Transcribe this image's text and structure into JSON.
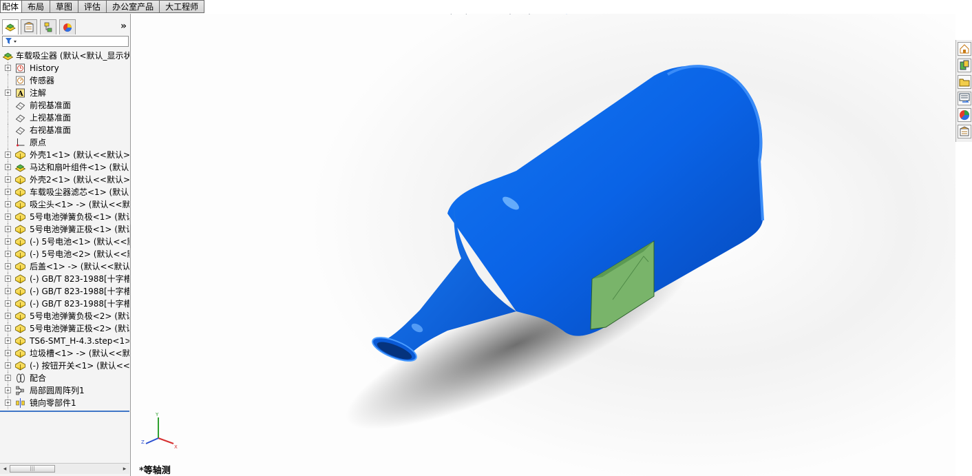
{
  "tabs": [
    "配体",
    "布局",
    "草图",
    "评估",
    "办公室产品",
    "大工程师"
  ],
  "panel": {
    "more_glyph": "»",
    "tabs": [
      "feature-manager-icon",
      "property-manager-icon",
      "configuration-manager-icon",
      "display-manager-icon"
    ]
  },
  "tree": {
    "root_label": "车载吸尘器  (默认<默认_显示状",
    "items": [
      {
        "label": "History",
        "icon": "history-folder-icon",
        "expand": "+"
      },
      {
        "label": "传感器",
        "icon": "sensor-icon",
        "expand": ""
      },
      {
        "label": "注解",
        "icon": "annotation-icon",
        "expand": "+"
      },
      {
        "label": "前视基准面",
        "icon": "plane-icon",
        "expand": ""
      },
      {
        "label": "上视基准面",
        "icon": "plane-icon",
        "expand": ""
      },
      {
        "label": "右视基准面",
        "icon": "plane-icon",
        "expand": ""
      },
      {
        "label": "原点",
        "icon": "origin-icon",
        "expand": ""
      },
      {
        "label": "外壳1<1> (默认<<默认>_",
        "icon": "part-icon",
        "expand": "+"
      },
      {
        "label": "马达和扇叶组件<1> (默认<",
        "icon": "subassembly-icon",
        "expand": "+"
      },
      {
        "label": "外壳2<1> (默认<<默认>_",
        "icon": "part-icon",
        "expand": "+"
      },
      {
        "label": "车载吸尘器滤芯<1> (默认<",
        "icon": "part-icon",
        "expand": "+"
      },
      {
        "label": "吸尘头<1> -> (默认<<默认",
        "icon": "part-icon",
        "expand": "+"
      },
      {
        "label": "5号电池弹簧负极<1> (默认",
        "icon": "part-icon",
        "expand": "+"
      },
      {
        "label": "5号电池弹簧正极<1> (默认",
        "icon": "part-icon",
        "expand": "+"
      },
      {
        "label": "(-) 5号电池<1> (默认<<默",
        "icon": "part-icon",
        "expand": "+"
      },
      {
        "label": "(-) 5号电池<2> (默认<<默",
        "icon": "part-icon",
        "expand": "+"
      },
      {
        "label": "后盖<1> -> (默认<<默认>",
        "icon": "part-icon",
        "expand": "+"
      },
      {
        "label": "(-) GB/T 823-1988[十字槽",
        "icon": "part-icon",
        "expand": "+"
      },
      {
        "label": "(-) GB/T 823-1988[十字槽",
        "icon": "part-icon",
        "expand": "+"
      },
      {
        "label": "(-) GB/T 823-1988[十字槽",
        "icon": "part-icon",
        "expand": "+"
      },
      {
        "label": "5号电池弹簧负极<2> (默认",
        "icon": "part-icon",
        "expand": "+"
      },
      {
        "label": "5号电池弹簧正极<2> (默认",
        "icon": "part-icon",
        "expand": "+"
      },
      {
        "label": "TS6-SMT_H-4.3.step<1>",
        "icon": "part-icon",
        "expand": "+"
      },
      {
        "label": "垃圾槽<1> -> (默认<<默认",
        "icon": "part-icon",
        "expand": "+"
      },
      {
        "label": "(-) 按钮开关<1> (默认<<默",
        "icon": "part-icon",
        "expand": "+"
      },
      {
        "label": "配合",
        "icon": "mates-icon",
        "expand": "+"
      },
      {
        "label": "局部圆周阵列1",
        "icon": "circular-pattern-icon",
        "expand": "+"
      },
      {
        "label": "镜向零部件1",
        "icon": "mirror-component-icon",
        "expand": "+"
      }
    ]
  },
  "viewport": {
    "view_label": "*等轴测",
    "triad_axes": [
      "Y",
      "X",
      "Z"
    ],
    "model_color": "#0a63e6",
    "window_color": "#79b46a"
  },
  "heads_up_toolbar": [
    "zoom-to-fit-icon",
    "zoom-to-area-icon",
    "previous-view-icon",
    "section-view-icon",
    "view-orientation-icon",
    "display-style-icon",
    "hide-show-items-icon",
    "edit-appearance-icon",
    "apply-scene-icon",
    "view-settings-icon",
    "rebuild-icon"
  ],
  "task_pane": [
    "solidworks-resources-icon",
    "design-library-icon",
    "file-explorer-icon",
    "view-palette-icon",
    "appearances-icon",
    "custom-properties-icon"
  ],
  "hscroll": {
    "left": "◂",
    "right": "▸",
    "thumb": "|||"
  },
  "collapse_glyph": "◂"
}
